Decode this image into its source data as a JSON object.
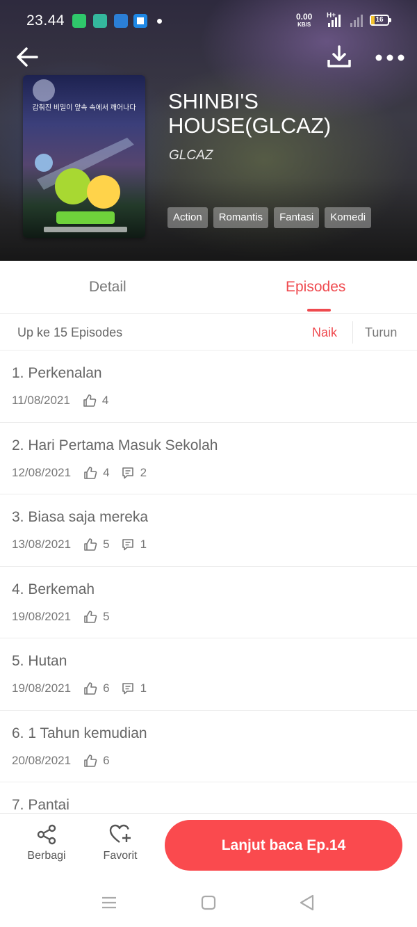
{
  "status_bar": {
    "time": "23.44",
    "net_speed_value": "0.00",
    "net_speed_unit": "KB/S",
    "network_type": "H+",
    "battery": "16"
  },
  "header": {
    "title": "SHINBI'S HOUSE(GLCAZ)",
    "author": "GLCAZ",
    "cover_text": "감춰진 비밀이 앞속 속에서 깨어나다",
    "tags": [
      "Action",
      "Romantis",
      "Fantasi",
      "Komedi"
    ],
    "icons": {
      "back": "back-arrow-icon",
      "download": "download-icon",
      "more": "more-dots-icon"
    }
  },
  "tabs": [
    {
      "label": "Detail",
      "active": false
    },
    {
      "label": "Episodes",
      "active": true
    }
  ],
  "sort_bar": {
    "count_label": "Up ke 15 Episodes",
    "ascending_label": "Naik",
    "descending_label": "Turun",
    "active": "ascending"
  },
  "episodes": [
    {
      "title": "1. Perkenalan",
      "date": "11/08/2021",
      "likes": "4",
      "comments": ""
    },
    {
      "title": "2. Hari Pertama Masuk Sekolah",
      "date": "12/08/2021",
      "likes": "4",
      "comments": "2"
    },
    {
      "title": "3. Biasa saja mereka",
      "date": "13/08/2021",
      "likes": "5",
      "comments": "1"
    },
    {
      "title": "4. Berkemah",
      "date": "19/08/2021",
      "likes": "5",
      "comments": ""
    },
    {
      "title": "5. Hutan",
      "date": "19/08/2021",
      "likes": "6",
      "comments": "1"
    },
    {
      "title": "6. 1 Tahun kemudian",
      "date": "20/08/2021",
      "likes": "6",
      "comments": ""
    },
    {
      "title": "7. Pantai",
      "date": "",
      "likes": "",
      "comments": ""
    }
  ],
  "action_bar": {
    "share_label": "Berbagi",
    "favorite_label": "Favorit",
    "continue_label": "Lanjut baca Ep.14"
  },
  "colors": {
    "accent": "#ef4a4f",
    "button": "#fa4a4e",
    "text_muted": "#777777"
  }
}
